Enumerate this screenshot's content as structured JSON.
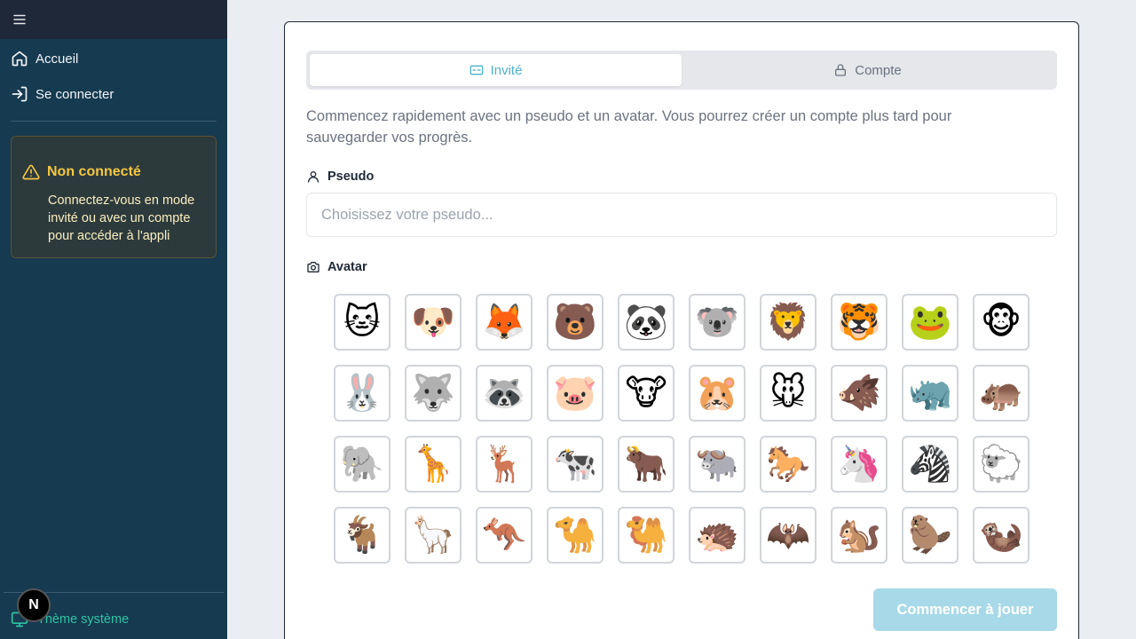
{
  "sidebar": {
    "nav": [
      {
        "label": "Accueil",
        "icon": "home-icon"
      },
      {
        "label": "Se connecter",
        "icon": "login-icon"
      }
    ],
    "warning": {
      "title": "Non connecté",
      "text": "Connectez-vous en mode invité ou avec un compte pour accéder à l'appli"
    },
    "theme_label": "Thème système",
    "badge_letter": "N"
  },
  "auth": {
    "tabs": [
      {
        "label": "Invité",
        "icon": "id-card-icon",
        "active": true
      },
      {
        "label": "Compte",
        "icon": "lock-icon",
        "active": false
      }
    ],
    "intro": "Commencez rapidement avec un pseudo et un avatar. Vous pourrez créer un compte plus tard pour sauvegarder vos progrès.",
    "pseudo_label": "Pseudo",
    "pseudo_placeholder": "Choisissez votre pseudo...",
    "pseudo_value": "",
    "avatar_label": "Avatar",
    "avatars": [
      "🐱",
      "🐶",
      "🦊",
      "🐻",
      "🐼",
      "🐨",
      "🦁",
      "🐯",
      "🐸",
      "🐵",
      "🐰",
      "🐺",
      "🦝",
      "🐷",
      "🐮",
      "🐹",
      "🐭",
      "🐗",
      "🦏",
      "🦛",
      "🐘",
      "🦒",
      "🦌",
      "🐄",
      "🐂",
      "🐃",
      "🐎",
      "🦄",
      "🦓",
      "🐑",
      "🐐",
      "🦙",
      "🦘",
      "🐪",
      "🐫",
      "🦔",
      "🦇",
      "🐿️",
      "🦫",
      "🦦"
    ],
    "start_label": "Commencer à jouer"
  },
  "colors": {
    "sidebar_bg": "#163a50",
    "accent": "#4fb2cf",
    "warning": "#f5c842",
    "theme": "#2ec4a2",
    "button_disabled": "#a8d9e8"
  }
}
